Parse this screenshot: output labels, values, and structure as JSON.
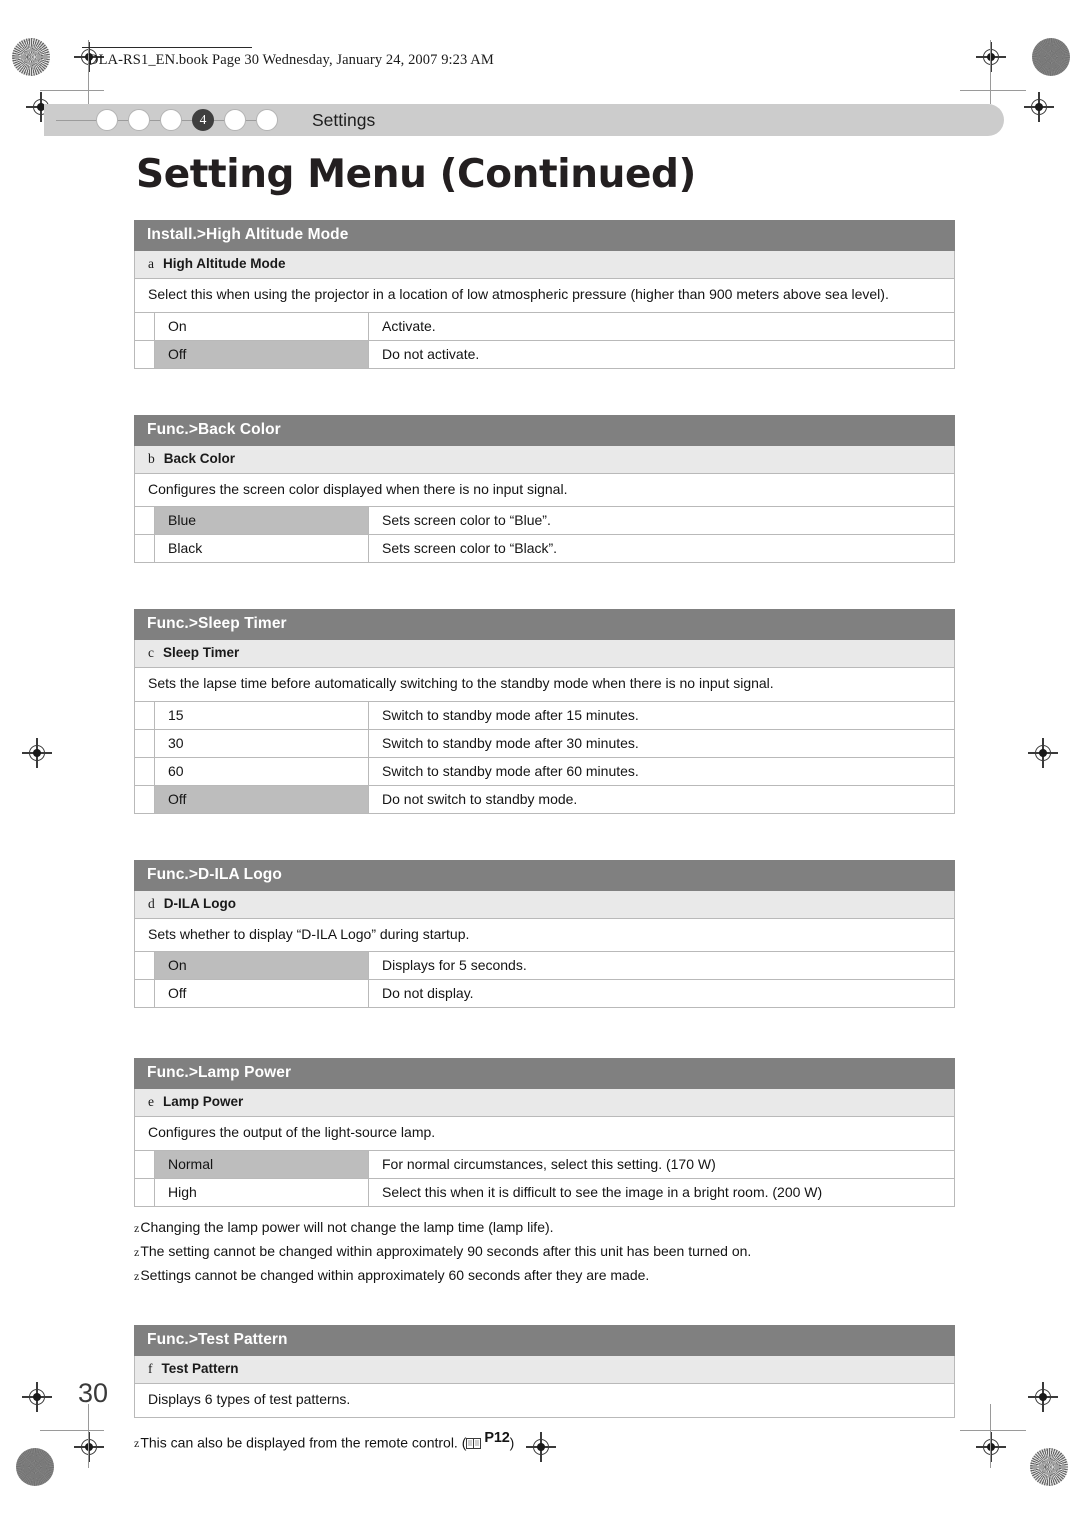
{
  "file_header": "DLA-RS1_EN.book  Page 30  Wednesday, January 24, 2007  9:23 AM",
  "nav": {
    "dots": [
      "",
      "",
      "",
      "4",
      "",
      ""
    ],
    "active_index": 3,
    "label": "Settings"
  },
  "page_title": "Setting Menu (Continued)",
  "page_number": "30",
  "sections": [
    {
      "head": "Install.>High Altitude Mode",
      "index": "a",
      "sub": "High Altitude Mode",
      "desc": "Select this when using the projector in a location of low atmospheric pressure (higher than 900 meters above sea level).",
      "rows": [
        {
          "option": "On",
          "detail": "Activate.",
          "highlight": false
        },
        {
          "option": "Off",
          "detail": "Do not activate.",
          "highlight": true
        }
      ]
    },
    {
      "head": "Func.>Back Color",
      "index": "b",
      "sub": "Back Color",
      "desc": "Configures the screen color displayed when there is no input signal.",
      "rows": [
        {
          "option": "Blue",
          "detail": "Sets screen color to “Blue”.",
          "highlight": true
        },
        {
          "option": "Black",
          "detail": "Sets screen color to “Black”.",
          "highlight": false
        }
      ]
    },
    {
      "head": "Func.>Sleep Timer",
      "index": "c",
      "sub": "Sleep Timer",
      "desc": "Sets the lapse time before automatically switching to the standby mode when there is no input signal.",
      "rows": [
        {
          "option": "15",
          "detail": "Switch to standby mode after 15 minutes.",
          "highlight": false
        },
        {
          "option": "30",
          "detail": "Switch to standby mode after 30 minutes.",
          "highlight": false
        },
        {
          "option": "60",
          "detail": "Switch to standby mode after 60 minutes.",
          "highlight": false
        },
        {
          "option": "Off",
          "detail": "Do not switch to standby mode.",
          "highlight": true
        }
      ]
    },
    {
      "head": "Func.>D-ILA Logo",
      "index": "d",
      "sub": "D-ILA Logo",
      "desc": "Sets whether to display “D-ILA Logo” during startup.",
      "rows": [
        {
          "option": "On",
          "detail": "Displays for 5 seconds.",
          "highlight": true
        },
        {
          "option": "Off",
          "detail": "Do not display.",
          "highlight": false
        }
      ]
    },
    {
      "head": "Func.>Lamp Power",
      "index": "e",
      "sub": "Lamp Power",
      "desc": "Configures the output of the light-source lamp.",
      "rows": [
        {
          "option": "Normal",
          "detail": "For normal circumstances, select this setting. (170 W)",
          "highlight": true
        },
        {
          "option": "High",
          "detail": "Select this when it is difficult to see the image in a bright room. (200 W)",
          "highlight": false
        }
      ]
    },
    {
      "head": "Func.>Test Pattern",
      "index": "f",
      "sub": "Test Pattern",
      "desc": "Displays 6 types of test patterns.",
      "rows": []
    }
  ],
  "lamp_notes": {
    "bullet": "z",
    "items": [
      "Changing the lamp power will not change the lamp time (lamp life).",
      "The setting cannot be changed within approximately 90 seconds after this unit has been turned on.",
      "Settings cannot be changed within approximately 60 seconds after they are made."
    ]
  },
  "test_pattern_note": {
    "bullet": "z",
    "text_before": "This can also be displayed from the remote control. (",
    "page_ref": "P12",
    "text_after": ")"
  },
  "colors": {
    "section_header_bg": "#808080",
    "section_sub_bg": "#e9e9e9",
    "row_highlight_bg": "#bdbdbd",
    "nav_strip_bg": "#cccccc",
    "nav_active_dot": "#3f3f3f",
    "border": "#b9b9b9"
  }
}
